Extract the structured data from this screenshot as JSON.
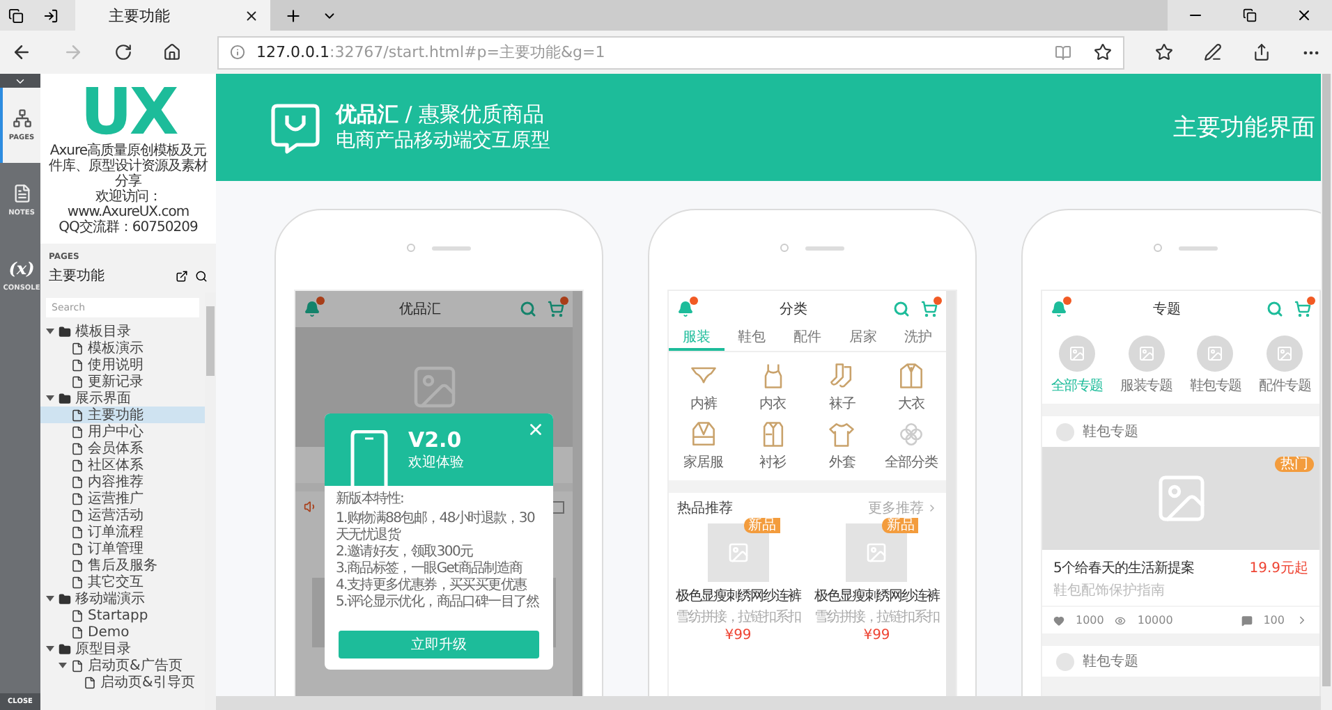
{
  "browser": {
    "tab_title": "主要功能",
    "address_host": "127.0.0.1",
    "address_path": ":32767/start.html#p=主要功能&g=1"
  },
  "rail": {
    "items": [
      {
        "label": "PAGES",
        "selected": true
      },
      {
        "label": "NOTES",
        "selected": false
      },
      {
        "label": "CONSOLE",
        "selected": false,
        "glyph": "(x)"
      }
    ],
    "close": "CLOSE"
  },
  "sidebar": {
    "logo": "UX",
    "intro": "Axure高质量原创模板及元件库、原型设计资源及素材分享",
    "website": "欢迎访问：www.AxureUX.com",
    "qq": "QQ交流群：60750209",
    "pages_label": "PAGES",
    "current_page": "主要功能",
    "search": {
      "placeholder": "Search"
    },
    "tree": [
      {
        "label": "模板目录",
        "kind": "folder",
        "selected": false,
        "expanded": true,
        "children": [
          {
            "label": "模板演示",
            "kind": "page",
            "selected": false
          },
          {
            "label": "使用说明",
            "kind": "page",
            "selected": false
          },
          {
            "label": "更新记录",
            "kind": "page",
            "selected": false
          }
        ]
      },
      {
        "label": "展示界面",
        "kind": "folder",
        "selected": false,
        "expanded": true,
        "children": [
          {
            "label": "主要功能",
            "kind": "page",
            "selected": true
          },
          {
            "label": "用户中心",
            "kind": "page",
            "selected": false
          },
          {
            "label": "会员体系",
            "kind": "page",
            "selected": false
          },
          {
            "label": "社区体系",
            "kind": "page",
            "selected": false
          },
          {
            "label": "内容推荐",
            "kind": "page",
            "selected": false
          },
          {
            "label": "运营推广",
            "kind": "page",
            "selected": false
          },
          {
            "label": "运营活动",
            "kind": "page",
            "selected": false
          },
          {
            "label": "订单流程",
            "kind": "page",
            "selected": false
          },
          {
            "label": "订单管理",
            "kind": "page",
            "selected": false
          },
          {
            "label": "售后及服务",
            "kind": "page",
            "selected": false
          },
          {
            "label": "其它交互",
            "kind": "page",
            "selected": false
          }
        ]
      },
      {
        "label": "移动端演示",
        "kind": "folder",
        "selected": false,
        "expanded": true,
        "children": [
          {
            "label": "Startapp",
            "kind": "page",
            "selected": false
          },
          {
            "label": "Demo",
            "kind": "page",
            "selected": false
          }
        ]
      },
      {
        "label": "原型目录",
        "kind": "folder",
        "selected": false,
        "expanded": true,
        "children": [
          {
            "label": "启动页&广告页",
            "kind": "page",
            "selected": false,
            "expanded": true,
            "children": [
              {
                "label": "启动页&引导页",
                "kind": "page",
                "selected": false
              }
            ]
          }
        ]
      }
    ]
  },
  "header": {
    "brand": "**优品汇** / 惠聚优质商品",
    "subtitle": "电商产品移动端交互原型",
    "page_title": "主要功能界面"
  },
  "phones": [
    {
      "kind": "home",
      "title": "优品汇",
      "modal": {
        "version": "V2.0",
        "welcome": "欢迎体验",
        "features_title": "新版本特性:",
        "features": [
          "1.购物满88包邮，48小时退款，30天无忧退货",
          "2.邀请好友，领取300元",
          "3.商品标签，一眼Get商品制造商",
          "4.支持更多优惠券，买买买更优惠",
          "5.评论显示优化，商品口碑一目了然"
        ],
        "button": "立即升级"
      }
    },
    {
      "kind": "category",
      "title": "分类",
      "tabs": [
        {
          "label": "服装",
          "selected": true
        },
        {
          "label": "鞋包",
          "selected": false
        },
        {
          "label": "配件",
          "selected": false
        },
        {
          "label": "居家",
          "selected": false
        },
        {
          "label": "洗护",
          "selected": false
        }
      ],
      "categories": [
        "内裤",
        "内衣",
        "袜子",
        "大衣",
        "家居服",
        "衬衫",
        "外套",
        "全部分类"
      ],
      "section": "热品推荐",
      "more": "更多推荐",
      "products": [
        {
          "badge": "新品",
          "name": "极色显瘦刺绣网纱连裤",
          "desc": "雪纺拼接，拉链扣系扣",
          "price": "¥99"
        },
        {
          "badge": "新品",
          "name": "极色显瘦刺绣网纱连裤",
          "desc": "雪纺拼接，拉链扣系扣",
          "price": "¥99"
        }
      ]
    },
    {
      "kind": "topic",
      "title": "专题",
      "topics": [
        {
          "label": "全部专题",
          "selected": true
        },
        {
          "label": "服装专题",
          "selected": false
        },
        {
          "label": "鞋包专题",
          "selected": false
        },
        {
          "label": "配件专题",
          "selected": false
        }
      ],
      "card": {
        "source": "鞋包专题",
        "badge": "热门",
        "title": "5个给春天的生活新提案",
        "price": "19.9元起",
        "desc": "鞋包配饰保护指南",
        "likes": "1000",
        "views": "10000",
        "comments": "100"
      },
      "next_source": "鞋包专题"
    }
  ]
}
